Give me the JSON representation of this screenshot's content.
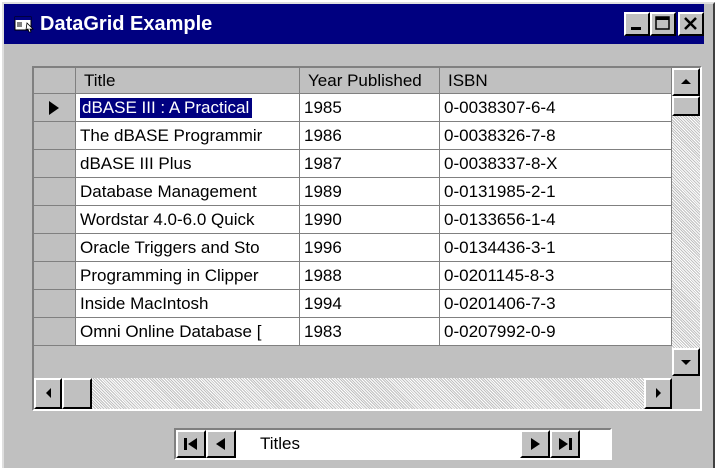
{
  "window": {
    "title": "DataGrid Example",
    "icon": "app-window-icon"
  },
  "caption_buttons": [
    "minimize-icon",
    "maximize-icon",
    "close-icon"
  ],
  "grid": {
    "columns": [
      "Title",
      "Year Published",
      "ISBN"
    ],
    "rows": [
      [
        "dBASE III : A Practical",
        "1985",
        "0-0038307-6-4"
      ],
      [
        "The dBASE Programmir",
        "1986",
        "0-0038326-7-8"
      ],
      [
        "dBASE III Plus",
        "1987",
        "0-0038337-8-X"
      ],
      [
        "Database Management",
        "1989",
        "0-0131985-2-1"
      ],
      [
        "Wordstar 4.0-6.0 Quick",
        "1990",
        "0-0133656-1-4"
      ],
      [
        "Oracle Triggers and Sto",
        "1996",
        "0-0134436-3-1"
      ],
      [
        "Programming in Clipper",
        "1988",
        "0-0201145-8-3"
      ],
      [
        "Inside MacIntosh",
        "1994",
        "0-0201406-7-3"
      ],
      [
        "Omni Online Database [",
        "1983",
        "0-0207992-0-9"
      ]
    ],
    "current_row": 0
  },
  "data_control": {
    "caption": "Titles",
    "buttons": [
      "move-first-icon",
      "move-previous-icon",
      "move-next-icon",
      "move-last-icon"
    ]
  },
  "colors": {
    "titlebar": "#000080",
    "selection": "#000080",
    "face": "#c0c0c0"
  }
}
